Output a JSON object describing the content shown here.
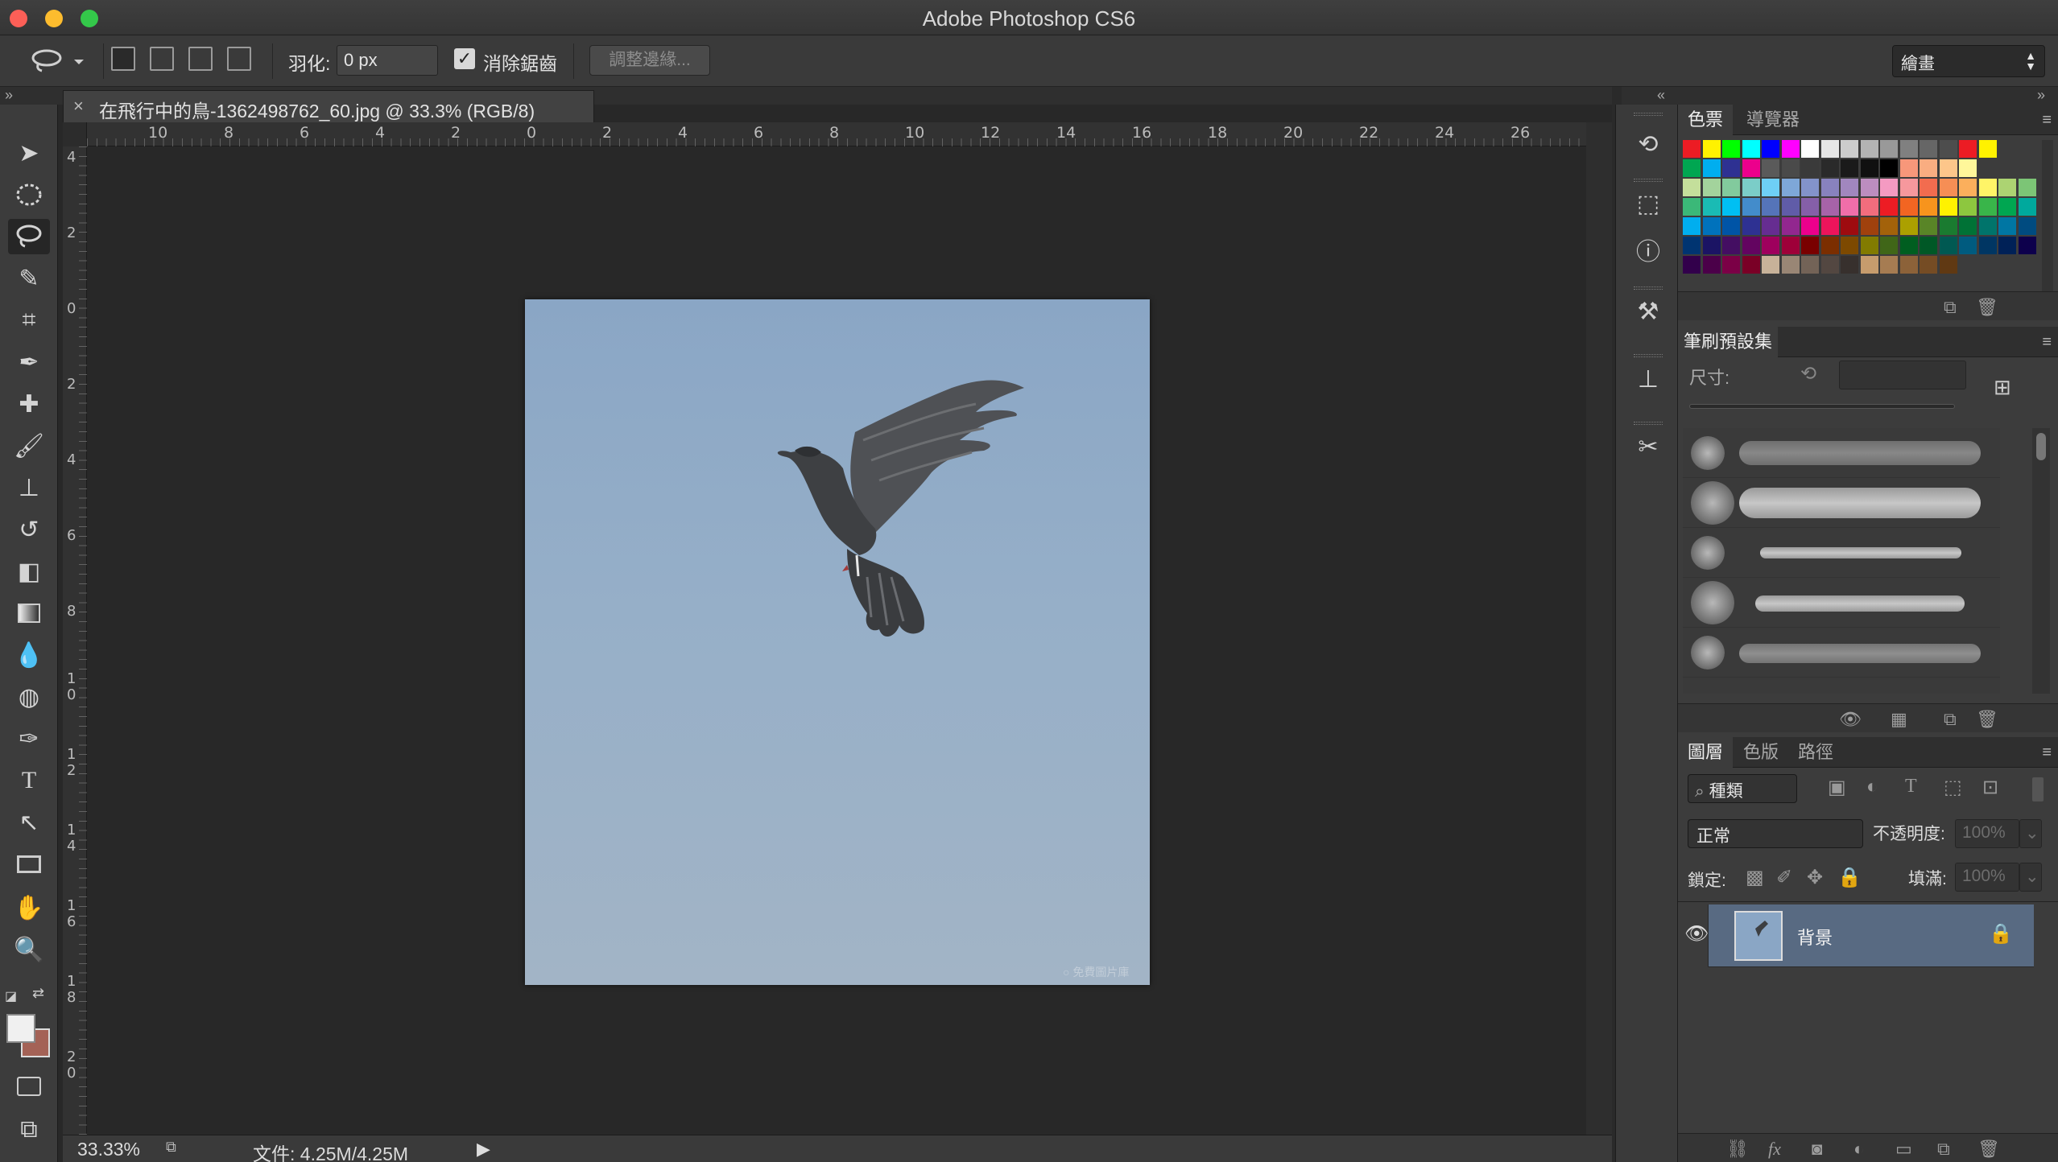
{
  "window": {
    "title": "Adobe Photoshop CS6",
    "traffic_colors": [
      "#fc5f57",
      "#fdbc2e",
      "#34c84a"
    ]
  },
  "options_bar": {
    "feather_label": "羽化:",
    "feather_value": "0 px",
    "antialias_label": "消除鋸齒",
    "antialias_checked": true,
    "refine_edge_label": "調整邊緣...",
    "workspace_value": "繪畫"
  },
  "document": {
    "tab_title": "在飛行中的鳥-1362498762_60.jpg @ 33.3% (RGB/8)",
    "close_glyph": "×",
    "ruler_h_labels": [
      "10",
      "8",
      "6",
      "4",
      "2",
      "0",
      "2",
      "4",
      "6",
      "8",
      "10",
      "12",
      "14",
      "16",
      "18",
      "20",
      "22",
      "24",
      "26"
    ],
    "ruler_v_labels": [
      "4",
      "2",
      "0",
      "2",
      "4",
      "6",
      "8",
      "10",
      "12",
      "14",
      "16",
      "18",
      "20"
    ],
    "watermark_text": "○ 免費圖片庫"
  },
  "status": {
    "zoom": "33.33%",
    "doc_info": "文件: 4.25M/4.25M"
  },
  "toolbar": {
    "tools": [
      "move-tool",
      "marquee-tool",
      "lasso-tool",
      "quick-select-tool",
      "crop-tool",
      "eyedropper-tool",
      "healing-brush-tool",
      "brush-tool",
      "clone-stamp-tool",
      "history-brush-tool",
      "eraser-tool",
      "gradient-tool",
      "blur-tool",
      "dodge-tool",
      "pen-tool",
      "type-tool",
      "path-select-tool",
      "shape-tool",
      "hand-tool",
      "zoom-tool"
    ],
    "foreground_color": "#f0f0f0",
    "background_color": "#a46256"
  },
  "dock": {
    "icons": [
      "history-icon",
      "three-d-icon",
      "info-icon",
      "tool-presets-icon",
      "clone-source-icon",
      "brush-icon"
    ]
  },
  "swatches_panel": {
    "tabs": [
      "色票",
      "導覽器"
    ],
    "colors": [
      [
        "#ec1c24",
        "#fff200",
        "#00ff00",
        "#00ffff",
        "#0000ff",
        "#ff00ff",
        "#ffffff",
        "#e6e6e6",
        "#cccccc",
        "#b3b3b3",
        "#999999",
        "#808080",
        "#666666",
        "#4d4d4d",
        "#ec1c24",
        "#fff200"
      ],
      [
        "#00a651",
        "#00aeef",
        "#2e3192",
        "#ec008c",
        "#5a5a5a",
        "#4a4a4a",
        "#3a3a3a",
        "#2a2a2a",
        "#1a1a1a",
        "#101010",
        "#000000",
        "#f7977a",
        "#f9ad81",
        "#fdc68a",
        "#fff79a"
      ],
      [
        "#c4df9b",
        "#a3d39c",
        "#82ca9d",
        "#7bcdc8",
        "#6ecff6",
        "#7ea7d8",
        "#8393ca",
        "#8882be",
        "#a187be",
        "#bc8dbf",
        "#f49ac2",
        "#f6989d",
        "#f26c4f",
        "#f68e55",
        "#fbaf5c",
        "#fff467",
        "#acd372",
        "#7cc576"
      ],
      [
        "#3bb878",
        "#1abbb4",
        "#00bff3",
        "#438ccb",
        "#5574b9",
        "#605ca8",
        "#855fa8",
        "#a763a8",
        "#f06ea9",
        "#f26d7d",
        "#ed1c24",
        "#f26522",
        "#f7941d",
        "#fff200",
        "#8dc73f",
        "#39b54a",
        "#00a651",
        "#00a99d"
      ],
      [
        "#00aeef",
        "#0072bc",
        "#0054a6",
        "#2e3192",
        "#662d91",
        "#92278f",
        "#ec008c",
        "#ed145b",
        "#9e0b0f",
        "#a0410d",
        "#a3620a",
        "#aba000",
        "#598527",
        "#1a7b30",
        "#007236",
        "#00746b",
        "#0076a3",
        "#004b80"
      ],
      [
        "#003471",
        "#1b1464",
        "#440e62",
        "#630460",
        "#9e005d",
        "#9e0039",
        "#790000",
        "#7b2e00",
        "#7d4900",
        "#827b00",
        "#406618",
        "#005e20",
        "#005826",
        "#005952",
        "#005b7f",
        "#003663",
        "#002157",
        "#0d004c"
      ],
      [
        "#32004b",
        "#4b0049",
        "#7b0046",
        "#7a0026",
        "#c7b299",
        "#998675",
        "#736357",
        "#534741",
        "#37302d",
        "#c69c6d",
        "#a67c52",
        "#8c6239",
        "#754c24",
        "#603913"
      ]
    ]
  },
  "brushes_panel": {
    "title": "筆刷預設集",
    "size_label": "尺寸:",
    "brush_count": 5
  },
  "layers_panel": {
    "tabs": [
      "圖層",
      "色版",
      "路徑"
    ],
    "filter_kind": "種類",
    "blend_mode": "正常",
    "opacity_label": "不透明度:",
    "opacity_value": "100%",
    "lock_label": "鎖定:",
    "fill_label": "填滿:",
    "fill_value": "100%",
    "layers": [
      {
        "name": "背景",
        "visible": true,
        "locked": true
      }
    ]
  }
}
